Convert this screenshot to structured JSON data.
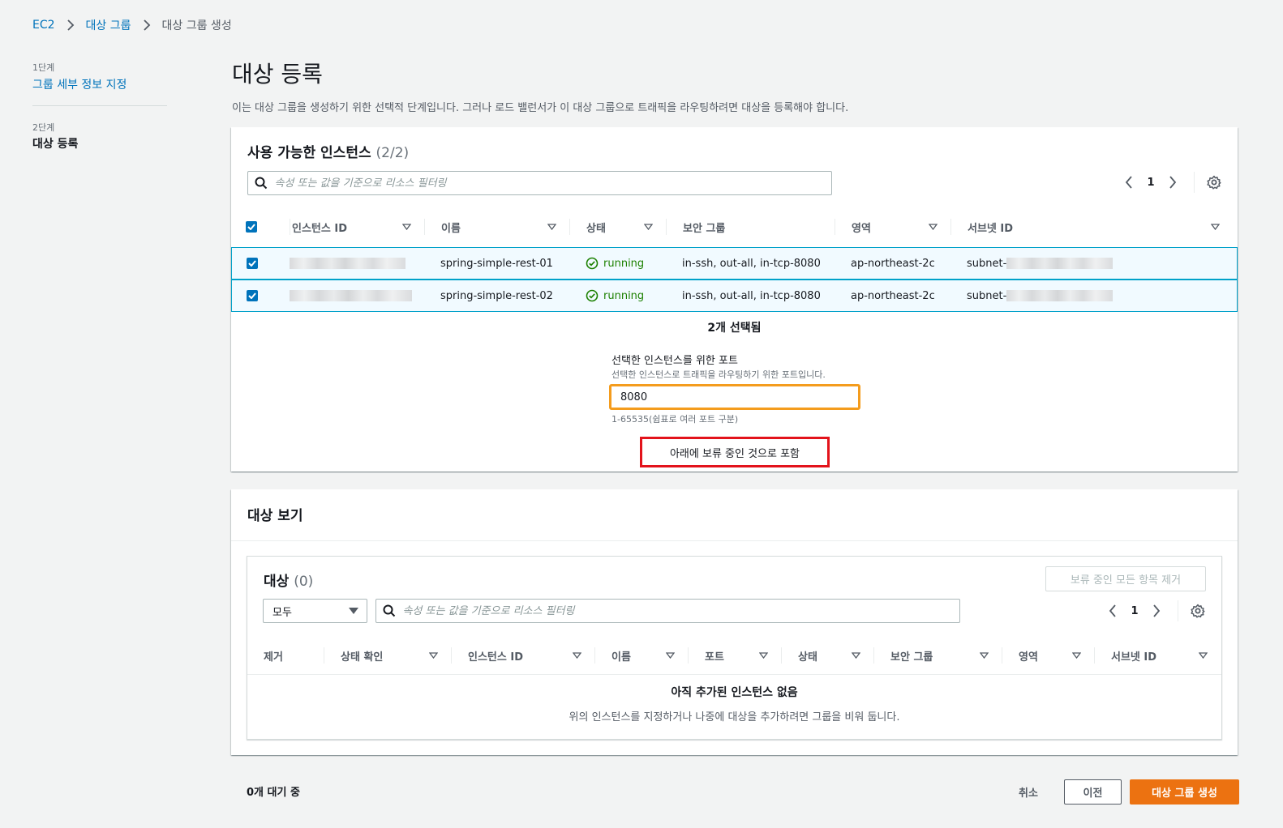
{
  "breadcrumb": {
    "items": [
      "EC2",
      "대상 그룹",
      "대상 그룹 생성"
    ]
  },
  "steps": [
    {
      "step": "1단계",
      "label": "그룹 세부 정보 지정"
    },
    {
      "step": "2단계",
      "label": "대상 등록"
    }
  ],
  "page": {
    "title": "대상 등록",
    "description": "이는 대상 그룹을 생성하기 위한 선택적 단계입니다. 그러나 로드 밸런서가 이 대상 그룹으로 트래픽을 라우팅하려면 대상을 등록해야 합니다."
  },
  "available": {
    "title": "사용 가능한 인스턴스",
    "count": "(2/2)",
    "search_placeholder": "속성 또는 값을 기준으로 리소스 필터링",
    "page": "1",
    "columns": [
      "인스턴스 ID",
      "이름",
      "상태",
      "보안 그룹",
      "영역",
      "서브넷 ID"
    ],
    "rows": [
      {
        "name": "spring-simple-rest-01",
        "state": "running",
        "sg": "in-ssh, out-all, in-tcp-8080",
        "zone": "ap-northeast-2c",
        "subnet": "subnet-"
      },
      {
        "name": "spring-simple-rest-02",
        "state": "running",
        "sg": "in-ssh, out-all, in-tcp-8080",
        "zone": "ap-northeast-2c",
        "subnet": "subnet-"
      }
    ],
    "selected_text": "2개 선택됨",
    "port_label": "선택한 인스턴스를 위한 포트",
    "port_desc": "선택한 인스턴스로 트래픽을 라우팅하기 위한 포트입니다.",
    "port_value": "8080",
    "port_hint": "1-65535(쉼표로 여러 포트 구분)",
    "include_button": "아래에 보류 중인 것으로 포함"
  },
  "review": {
    "title": "대상 보기",
    "targets_title": "대상",
    "targets_count": "(0)",
    "remove_all": "보류 중인 모든 항목 제거",
    "filter_select": "모두",
    "search_placeholder": "속성 또는 값을 기준으로 리소스 필터링",
    "page": "1",
    "columns": [
      "제거",
      "상태 확인",
      "인스턴스 ID",
      "이름",
      "포트",
      "상태",
      "보안 그룹",
      "영역",
      "서브넷 ID"
    ],
    "empty_title": "아직 추가된 인스턴스 없음",
    "empty_desc": "위의 인스턴스를 지정하거나 나중에 대상을 추가하려면 그룹을 비워 둡니다."
  },
  "footer": {
    "pending": "0개 대기 중",
    "cancel": "취소",
    "previous": "이전",
    "create": "대상 그룹 생성"
  },
  "colors": {
    "accent": "#0073bb",
    "primary": "#ec7211",
    "success": "#1d8102",
    "highlight_orange": "#f49c1d",
    "highlight_red": "#e3131b"
  }
}
